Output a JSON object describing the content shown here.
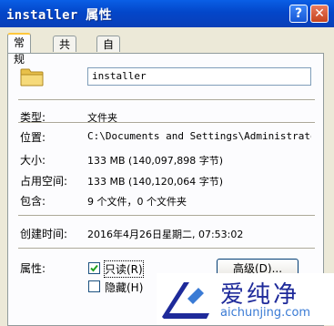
{
  "window": {
    "title": "installer 属性",
    "help_glyph": "?",
    "close_glyph": "✕"
  },
  "tabs": [
    {
      "label": "常规",
      "active": true
    },
    {
      "label": "共享",
      "active": false
    },
    {
      "label": "自定义",
      "active": false
    }
  ],
  "general": {
    "folder_name": "installer",
    "rows": {
      "type": {
        "label": "类型:",
        "value": "文件夹"
      },
      "location": {
        "label": "位置:",
        "value": "C:\\Documents and Settings\\Administrator\\L"
      },
      "size": {
        "label": "大小:",
        "value": "133 MB (140,097,898 字节)"
      },
      "size_on_disk": {
        "label": "占用空间:",
        "value": "133 MB (140,120,064 字节)"
      },
      "contains": {
        "label": "包含:",
        "value": "9 个文件，0 个文件夹"
      },
      "created": {
        "label": "创建时间:",
        "value": "2016年4月26日星期二, 07:53:02"
      }
    },
    "attributes": {
      "label": "属性:",
      "readonly": {
        "label": "只读(R)",
        "checked": true
      },
      "hidden": {
        "label": "隐藏(H)",
        "checked": false
      },
      "advanced_button": "高级(D)..."
    }
  },
  "watermark": {
    "text": "爱纯净",
    "url": "aichunjing.com"
  },
  "colors": {
    "titlebar": "#0A5FE6",
    "panel": "#FCFCFE",
    "dialog": "#ECE9D8",
    "tab_accent": "#FFC73C"
  }
}
